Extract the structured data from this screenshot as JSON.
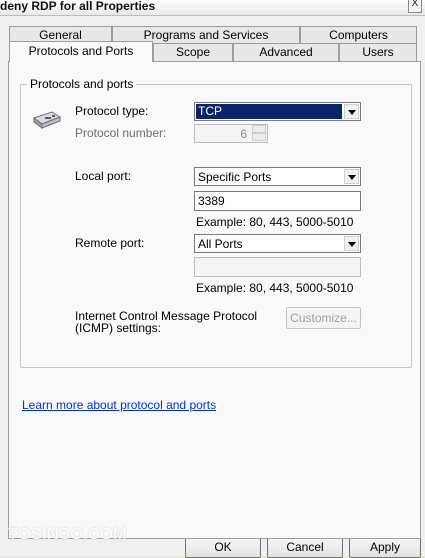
{
  "window": {
    "title": "deny RDP for all Properties",
    "close_glyph": "X"
  },
  "tabs_row1": [
    {
      "label": "General"
    },
    {
      "label": "Programs and Services"
    },
    {
      "label": "Computers"
    }
  ],
  "tabs_row2": [
    {
      "label": "Protocols and Ports",
      "active": true
    },
    {
      "label": "Scope"
    },
    {
      "label": "Advanced"
    },
    {
      "label": "Users"
    }
  ],
  "group": {
    "legend": "Protocols and ports",
    "icon": "network-adapter-icon",
    "protocol_type_label": "Protocol type:",
    "protocol_type_value": "TCP",
    "protocol_number_label": "Protocol number:",
    "protocol_number_value": "6",
    "local_port_label": "Local port:",
    "local_port_select": "Specific Ports",
    "local_port_value": "3389",
    "local_port_example": "Example: 80, 443, 5000-5010",
    "remote_port_label": "Remote port:",
    "remote_port_select": "All Ports",
    "remote_port_value": "",
    "remote_port_example": "Example: 80, 443, 5000-5010",
    "icmp_label_line1": "Internet Control Message Protocol",
    "icmp_label_line2": "(ICMP) settings:",
    "customize_label": "Customize..."
  },
  "learn_more_link": "Learn more about protocol and ports",
  "watermark": "TOSINSO.COM",
  "buttons": {
    "ok": "OK",
    "cancel": "Cancel",
    "apply": "Apply"
  },
  "colors": {
    "selection": "#0a246a",
    "link": "#0033cc",
    "panel": "#f9f9f9"
  }
}
